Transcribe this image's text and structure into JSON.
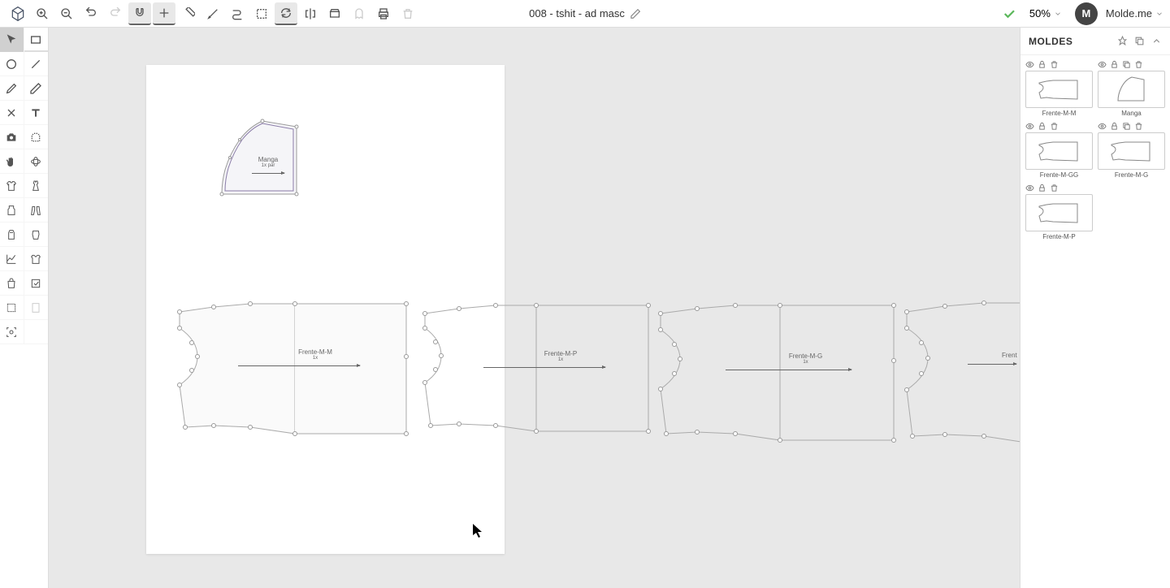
{
  "header": {
    "title": "008 - tshit - ad masc",
    "zoom": "50%",
    "user_initial": "M",
    "user_name": "Molde.me"
  },
  "panel": {
    "title": "MOLDES"
  },
  "moldes": [
    {
      "label": "Frente-M-M"
    },
    {
      "label": "Manga"
    },
    {
      "label": "Frente-M-GG"
    },
    {
      "label": "Frente-M-G"
    },
    {
      "label": "Frente-M-P"
    }
  ],
  "canvas": {
    "piece_manga": {
      "label": "Manga",
      "sub": "1x par"
    },
    "piece1": {
      "label": "Frente-M-M",
      "sub": "1x"
    },
    "piece2": {
      "label": "Frente-M-P",
      "sub": "1x"
    },
    "piece3": {
      "label": "Frente-M-G",
      "sub": "1x"
    },
    "piece4": {
      "label": "Frent",
      "sub": ""
    }
  }
}
